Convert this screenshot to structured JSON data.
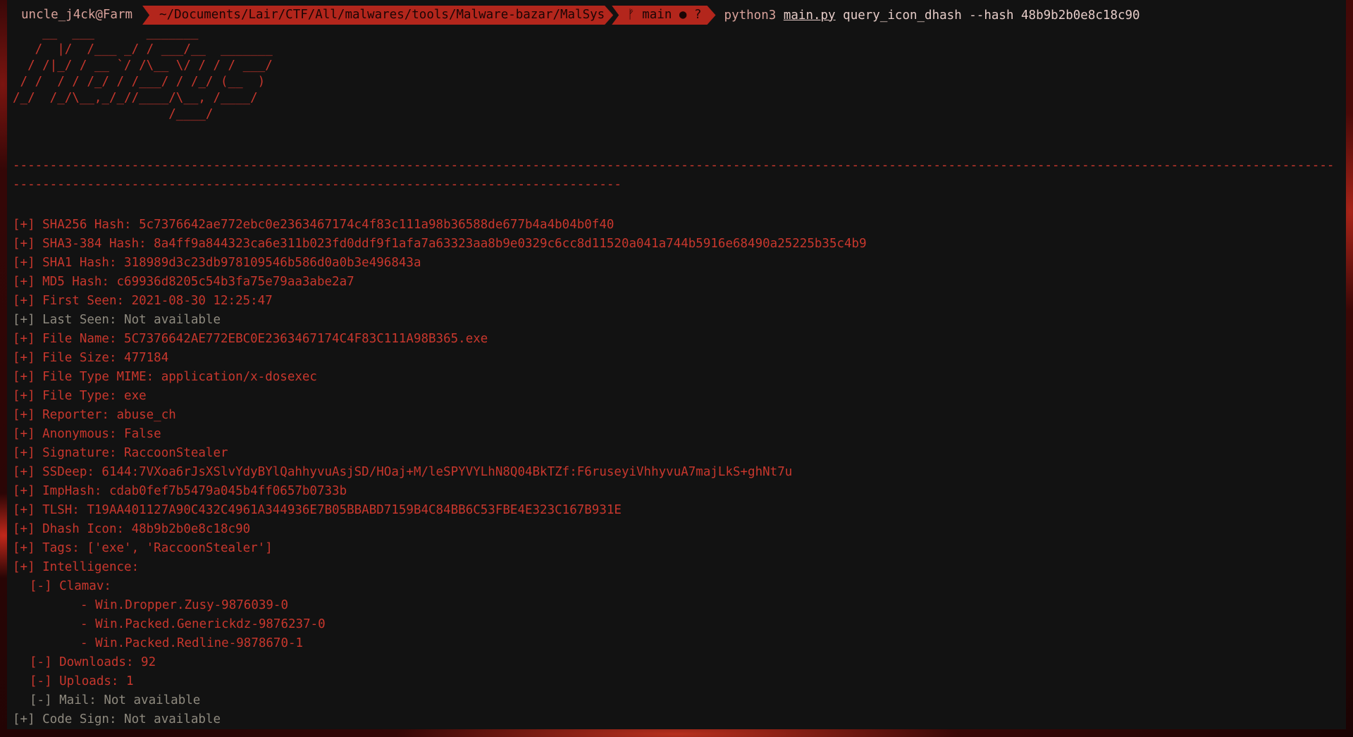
{
  "prompt": {
    "user": "uncle_j4ck@Farm",
    "path": "~/Documents/Lair/CTF/All/malwares/tools/Malware-bazar/MalSys",
    "git": "ᚠ main ● ?",
    "command_bin": "python3",
    "command_file": "main.py",
    "command_args": "query_icon_dhash --hash 48b9b2b0e8c18c90"
  },
  "banner": "    __  ___       _______\n   /  |/  /___ _/ / ___/__  _______\n  / /|_/ / __ `/ /\\__ \\/ / / / ___/\n / /  / / /_/ / /___/ / /_/ (__  )\n/_/  /_/\\__,_/_//____/\\__, /____/\n                     /____/",
  "divider": "--------------------------------------------------------------------------------------------------------------------------------------------------------------------------------------------------------------------------------------------------------------------",
  "output": [
    {
      "text": "[+] SHA256 Hash: 5c7376642ae772ebc0e2363467174c4f83c111a98b36588de677b4a4b04b0f40",
      "style": "normal"
    },
    {
      "text": "[+] SHA3-384 Hash: 8a4ff9a844323ca6e311b023fd0ddf9f1afa7a63323aa8b9e0329c6cc8d11520a041a744b5916e68490a25225b35c4b9",
      "style": "normal"
    },
    {
      "text": "[+] SHA1 Hash: 318989d3c23db978109546b586d0a0b3e496843a",
      "style": "normal"
    },
    {
      "text": "[+] MD5 Hash: c69936d8205c54b3fa75e79aa3abe2a7",
      "style": "normal"
    },
    {
      "text": "[+] First Seen: 2021-08-30 12:25:47",
      "style": "normal"
    },
    {
      "text": "[+] Last Seen: Not available",
      "style": "dim"
    },
    {
      "text": "[+] File Name: 5C7376642AE772EBC0E2363467174C4F83C111A98B365.exe",
      "style": "normal"
    },
    {
      "text": "[+] File Size: 477184",
      "style": "normal"
    },
    {
      "text": "[+] File Type MIME: application/x-dosexec",
      "style": "normal"
    },
    {
      "text": "[+] File Type: exe",
      "style": "normal"
    },
    {
      "text": "[+] Reporter: abuse_ch",
      "style": "normal"
    },
    {
      "text": "[+] Anonymous: False",
      "style": "normal"
    },
    {
      "text": "[+] Signature: RaccoonStealer",
      "style": "normal"
    },
    {
      "text": "[+] SSDeep: 6144:7VXoa6rJsXSlvYdyBYlQahhyvuAsjSD/HOaj+M/leSPYVYLhN8Q04BkTZf:F6ruseyiVhhyvuA7majLkS+ghNt7u",
      "style": "normal"
    },
    {
      "text": "[+] ImpHash: cdab0fef7b5479a045b4ff0657b0733b",
      "style": "normal"
    },
    {
      "text": "[+] TLSH: T19AA401127A90C432C4961A344936E7B05BBABD7159B4C84BB6C53FBE4E323C167B931E",
      "style": "normal"
    },
    {
      "text": "[+] Dhash Icon: 48b9b2b0e8c18c90",
      "style": "normal"
    },
    {
      "text": "[+] Tags: ['exe', 'RaccoonStealer']",
      "style": "normal"
    },
    {
      "text": "[+] Intelligence:",
      "style": "normal"
    },
    {
      "text": "[-] Clamav:",
      "style": "ind1"
    },
    {
      "text": "- Win.Dropper.Zusy-9876039-0",
      "style": "ind2"
    },
    {
      "text": "- Win.Packed.Generickdz-9876237-0",
      "style": "ind2"
    },
    {
      "text": "- Win.Packed.Redline-9878670-1",
      "style": "ind2"
    },
    {
      "text": "[-] Downloads: 92",
      "style": "ind1"
    },
    {
      "text": "[-] Uploads: 1",
      "style": "ind1"
    },
    {
      "text": "[-] Mail: Not available",
      "style": "ind1-dim"
    },
    {
      "text": "[+] Code Sign: Not available",
      "style": "dim"
    }
  ]
}
